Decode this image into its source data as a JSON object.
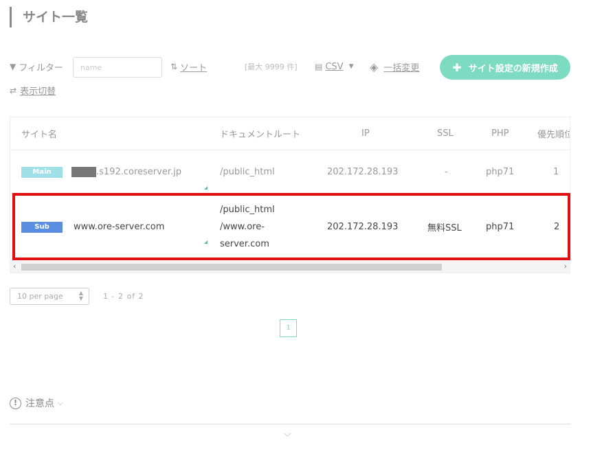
{
  "page": {
    "title": "サイト一覧"
  },
  "toolbar": {
    "filter_label": "フィルター",
    "filter_placeholder": "name",
    "sort_label": "ソート",
    "max_count": "[最大 9999 件]",
    "csv_label": "CSV",
    "bulk_change_label": "一括変更",
    "new_button_label": "サイト設定の新規作成",
    "display_switch_label": "表示切替",
    "icons": {
      "filter": "filter-icon",
      "sort": "sort-icon",
      "csv": "document-icon",
      "bulk": "layers-icon",
      "switch": "swap-icon",
      "new": "plus-icon"
    }
  },
  "table": {
    "columns": [
      "サイト名",
      "ドキュメントルート",
      "IP",
      "SSL",
      "PHP",
      "優先順位"
    ],
    "rows": [
      {
        "type_badge": "Main",
        "site_name": ".s192.coreserver.jp",
        "doc_root": "/public_html",
        "doc_root_lines": [
          "/public_html"
        ],
        "ip": "202.172.28.193",
        "ssl": "-",
        "php": "php71",
        "priority": "1"
      },
      {
        "type_badge": "Sub",
        "site_name": "www.ore-server.com",
        "doc_root_lines": [
          "/public_html",
          "/www.ore-",
          "server.com"
        ],
        "ip": "202.172.28.193",
        "ssl": "無料SSL",
        "php": "php71",
        "priority": "2"
      }
    ],
    "badge_colors": {
      "Main": "#9fdfe8",
      "Sub": "#5b8ee0"
    },
    "highlight_color": "#e01010"
  },
  "pagination": {
    "per_page": "10 per page",
    "range": "1 - 2 of 2",
    "current_page": "1"
  },
  "notes": {
    "label": "注意点"
  },
  "colors": {
    "accent": "#7ddbc1",
    "text_muted": "#999999"
  }
}
